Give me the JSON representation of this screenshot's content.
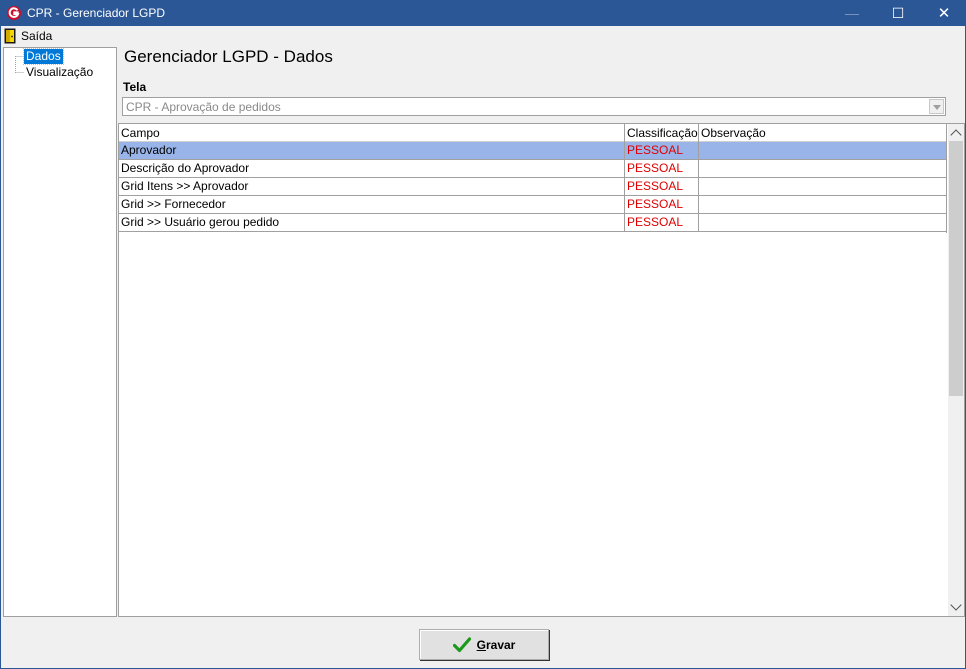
{
  "window": {
    "title": "CPR - Gerenciador LGPD",
    "minimize_glyph": "—",
    "maximize_glyph": "☐",
    "close_glyph": "✕"
  },
  "menu": {
    "exit_label": "Saída"
  },
  "tree": {
    "items": [
      {
        "label": "Dados",
        "selected": true
      },
      {
        "label": "Visualização",
        "selected": false
      }
    ]
  },
  "main": {
    "heading": "Gerenciador LGPD - Dados",
    "screen_label": "Tela",
    "screen_value": "CPR - Aprovação de pedidos"
  },
  "grid": {
    "columns": [
      "Campo",
      "Classificação",
      "Observação"
    ],
    "rows": [
      {
        "campo": "Aprovador",
        "classificacao": "PESSOAL",
        "observacao": "",
        "selected": true
      },
      {
        "campo": "Descrição do Aprovador",
        "classificacao": "PESSOAL",
        "observacao": "",
        "selected": false
      },
      {
        "campo": "Grid  Itens >> Aprovador",
        "classificacao": "PESSOAL",
        "observacao": "",
        "selected": false
      },
      {
        "campo": "Grid >> Fornecedor",
        "classificacao": "PESSOAL",
        "observacao": "",
        "selected": false
      },
      {
        "campo": "Grid >> Usuário gerou pedido",
        "classificacao": "PESSOAL",
        "observacao": "",
        "selected": false
      }
    ]
  },
  "footer": {
    "save_label": "Gravar",
    "save_mnemonic": "G",
    "save_rest": "ravar"
  },
  "colors": {
    "titlebar": "#2b5797",
    "selection_tree": "#0078d7",
    "selection_row": "#99b4e8",
    "classification_text": "#e00000"
  }
}
